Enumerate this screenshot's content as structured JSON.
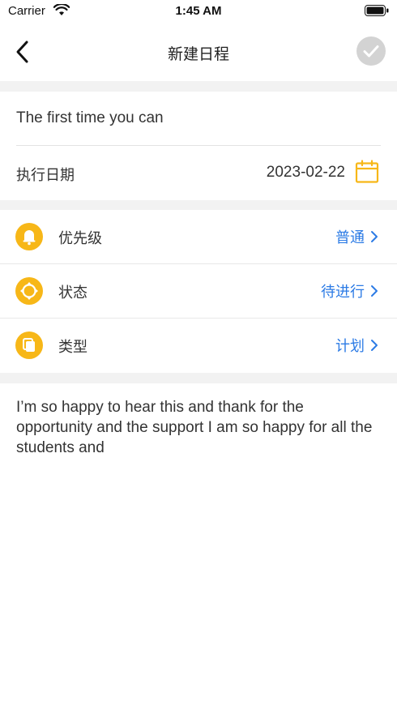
{
  "status_bar": {
    "carrier": "Carrier",
    "time": "1:45 AM"
  },
  "nav": {
    "title": "新建日程"
  },
  "form": {
    "title_value": "The first time you can",
    "date_label": "执行日期",
    "date_value": "2023-02-22"
  },
  "options": [
    {
      "label": "优先级",
      "value": "普通",
      "icon": "bell-icon"
    },
    {
      "label": "状态",
      "value": "待进行",
      "icon": "status-icon"
    },
    {
      "label": "类型",
      "value": "计划",
      "icon": "type-icon"
    }
  ],
  "notes": {
    "text": "I’m so happy to hear this and thank for the opportunity and the support I am so happy for all the students and"
  },
  "colors": {
    "accent": "#f7b718",
    "link": "#2c7be5",
    "divider": "#f2f2f2",
    "confirm": "#d3d3d3"
  }
}
